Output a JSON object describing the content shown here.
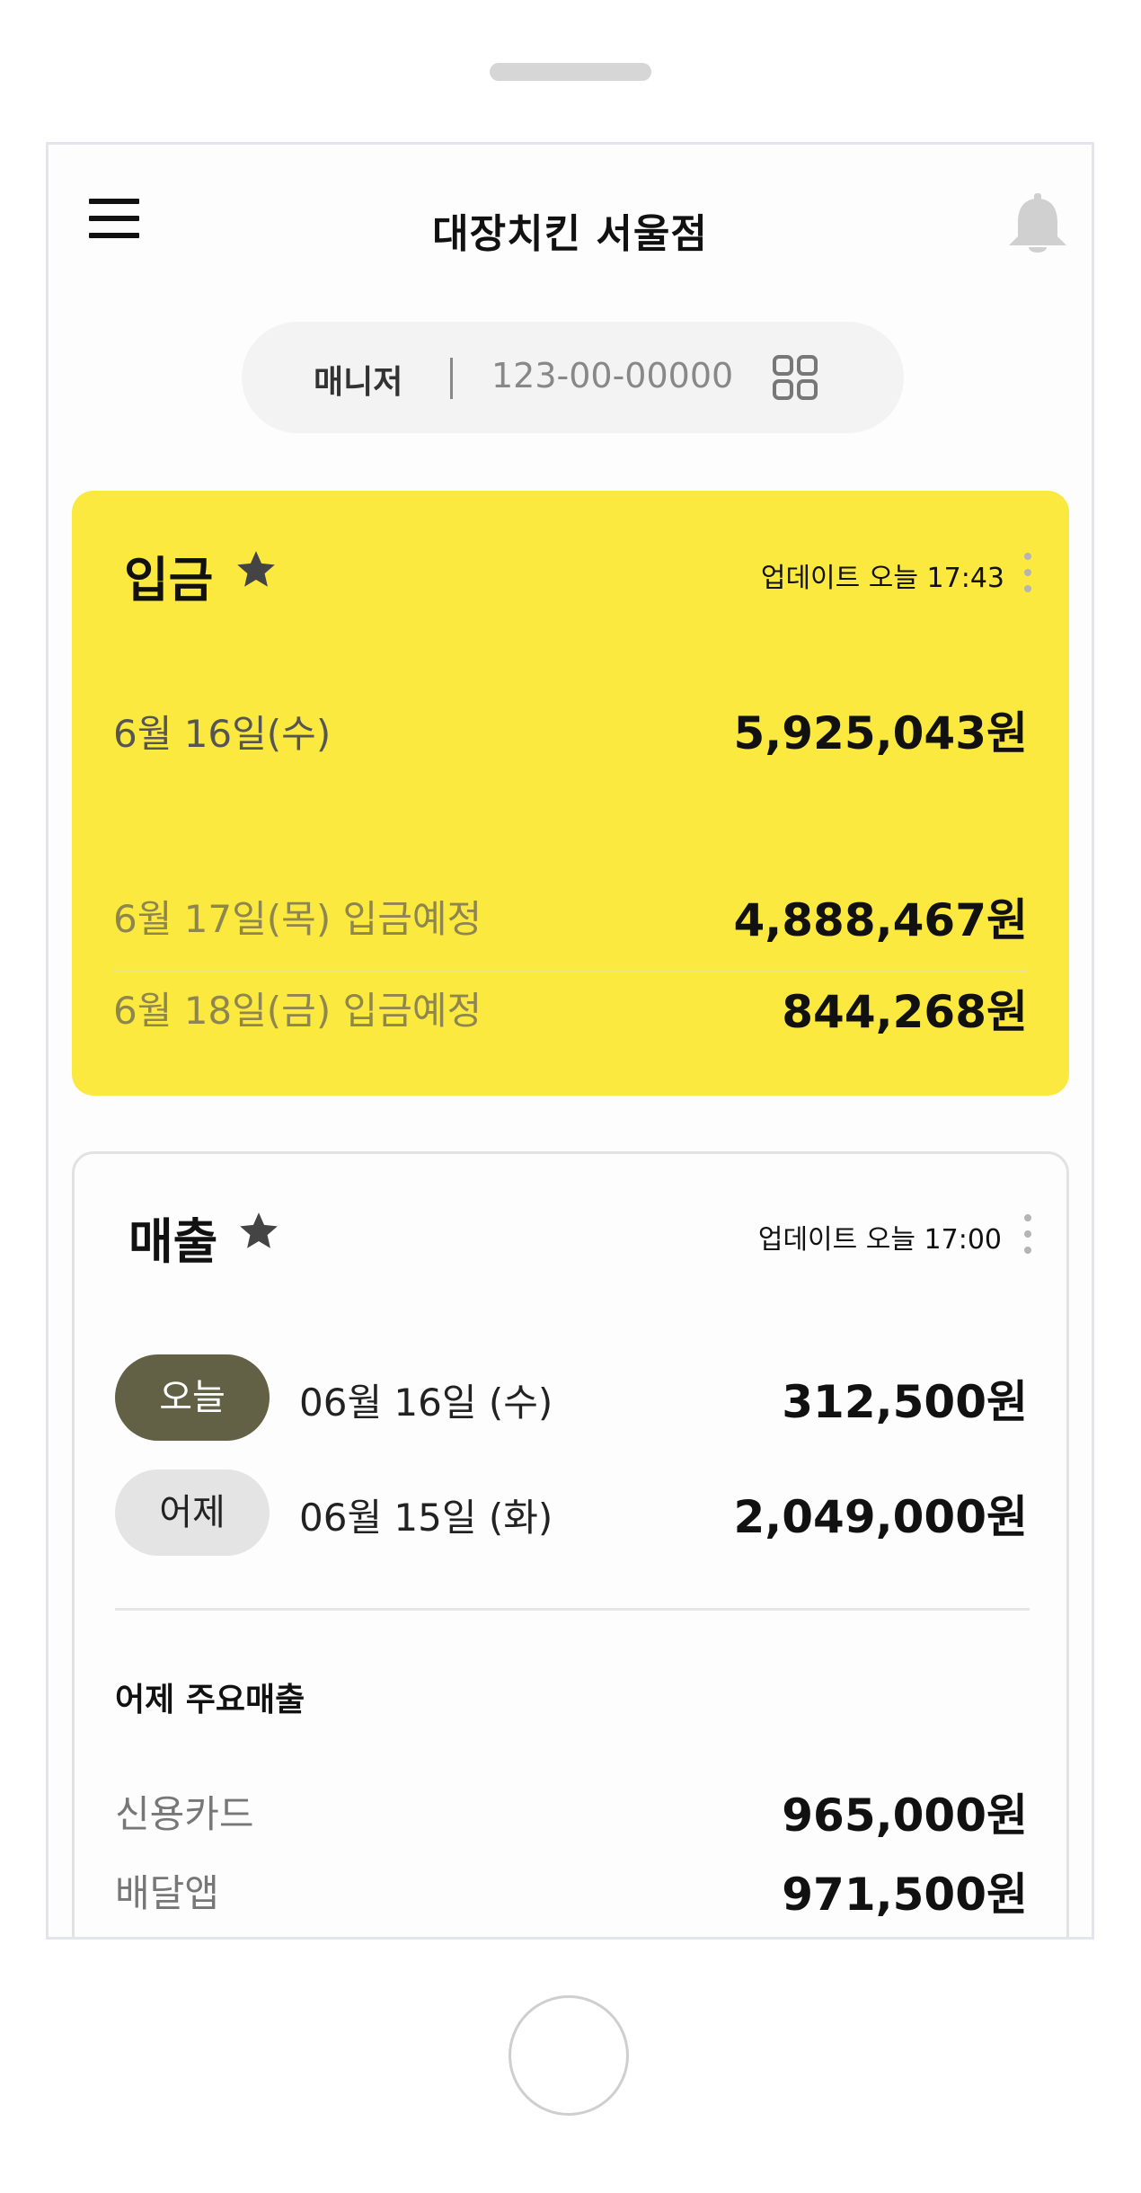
{
  "header": {
    "store_name": "대장치킨 서울점"
  },
  "business": {
    "role": "매니저",
    "number": "123-00-00000"
  },
  "deposit": {
    "title": "입금",
    "update": "업데이트 오늘 17:43",
    "today": {
      "label": "6월 16일(수)",
      "amount": "5,925,043원"
    },
    "scheduled": [
      {
        "label": "6월 17일(목) 입금예정",
        "amount": "4,888,467원"
      },
      {
        "label": "6월 18일(금) 입금예정",
        "amount": "844,268원"
      }
    ]
  },
  "sales": {
    "title": "매출",
    "update": "업데이트 오늘 17:00",
    "days": [
      {
        "chip": "오늘",
        "date": "06월 16일 (수)",
        "amount": "312,500원",
        "selected": true
      },
      {
        "chip": "어제",
        "date": "06월 15일 (화)",
        "amount": "2,049,000원",
        "selected": false
      }
    ],
    "breakdown_title": "어제 주요매출",
    "breakdown": [
      {
        "label": "신용카드",
        "amount": "965,000원"
      },
      {
        "label": "배달앱",
        "amount": "971,500원"
      }
    ]
  },
  "colors": {
    "deposit_card": "#fce93f",
    "chip_active": "#626045",
    "chip_inactive": "#e4e4e4"
  },
  "icons": {
    "menu": "menu-icon",
    "notification": "bell-icon",
    "qr": "grid-icon",
    "favorite": "star-icon",
    "more": "kebab-icon"
  }
}
